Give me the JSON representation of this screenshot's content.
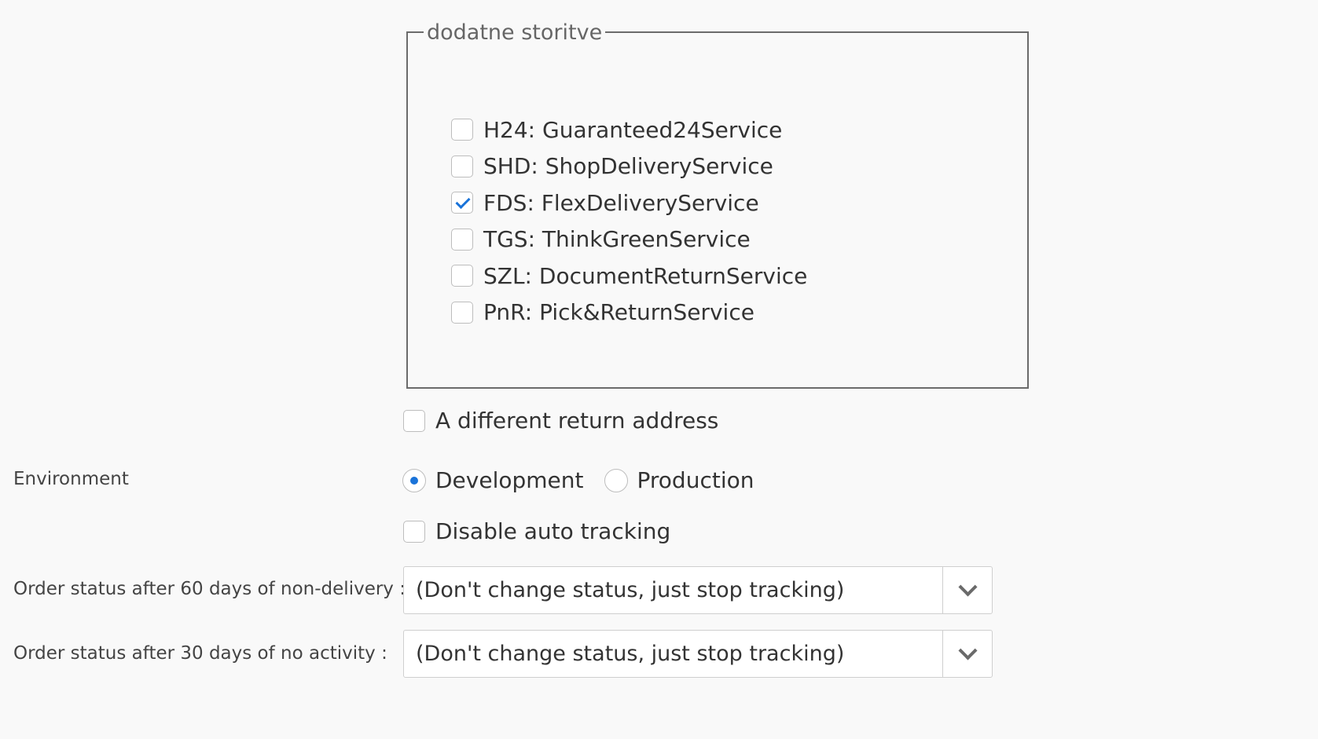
{
  "fieldset": {
    "legend": "dodatne storitve",
    "services": [
      {
        "label": "H24: Guaranteed24Service",
        "checked": false
      },
      {
        "label": "SHD: ShopDeliveryService",
        "checked": false
      },
      {
        "label": "FDS: FlexDeliveryService",
        "checked": true
      },
      {
        "label": "TGS: ThinkGreenService",
        "checked": false
      },
      {
        "label": "SZL: DocumentReturnService",
        "checked": false
      },
      {
        "label": "PnR: Pick&ReturnService",
        "checked": false
      }
    ]
  },
  "return_address": {
    "label": "A different return address",
    "checked": false
  },
  "environment": {
    "label": "Environment",
    "options": [
      {
        "label": "Development",
        "selected": true
      },
      {
        "label": "Production",
        "selected": false
      }
    ]
  },
  "auto_tracking": {
    "label": "Disable auto tracking",
    "checked": false
  },
  "non_delivery": {
    "label": "Order status after 60 days of non-delivery :",
    "value": "(Don't change status, just stop tracking)"
  },
  "no_activity": {
    "label": "Order status after 30 days of no activity :",
    "value": "(Don't change status, just stop tracking)"
  },
  "colors": {
    "accent": "#1a73d9",
    "border": "#6b6b6b",
    "background": "#f9f9f9"
  }
}
